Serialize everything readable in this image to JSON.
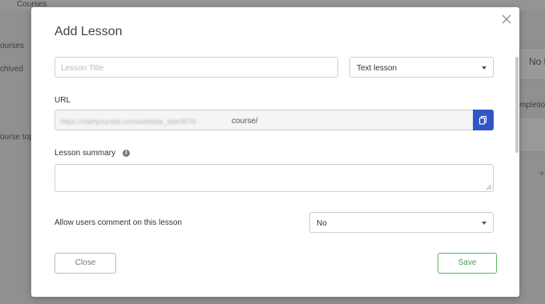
{
  "background": {
    "top_label": "Courses",
    "left_labels": [
      "ourses",
      "chived",
      "ourse top"
    ],
    "right_labels": [
      "No l",
      "mpletio"
    ]
  },
  "modal": {
    "title": "Add Lesson",
    "lesson_title": {
      "placeholder": "Lesson Title",
      "value": ""
    },
    "lesson_type": {
      "selected": "Text lesson"
    },
    "url": {
      "label": "URL",
      "value_blurred": "https://startyoursite.com/website_site0870/",
      "value_visible": "course/"
    },
    "summary": {
      "label": "Lesson summary",
      "value": ""
    },
    "comments": {
      "label": "Allow users comment on this lesson",
      "selected": "No"
    },
    "buttons": {
      "close": "Close",
      "save": "Save"
    }
  },
  "colors": {
    "accent_blue": "#2f55c8",
    "save_green": "#5cb85c",
    "overlay": "rgba(0,0,0,0.38)"
  },
  "icons": {
    "close": "close-icon",
    "copy": "copy-icon",
    "info": "info-icon",
    "caret": "chevron-down-icon"
  }
}
